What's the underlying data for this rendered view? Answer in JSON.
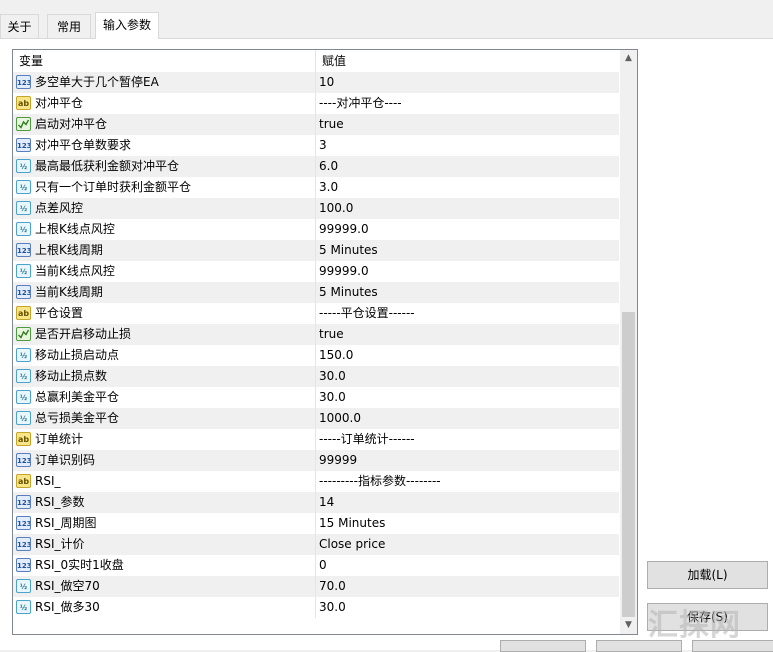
{
  "tabs": [
    {
      "label": "关于"
    },
    {
      "label": "常用"
    },
    {
      "label": "输入参数"
    }
  ],
  "table": {
    "col_variable": "变量",
    "col_value": "赋值",
    "rows": [
      {
        "icon": "int",
        "name": "多空单大于几个暂停EA",
        "value": "10"
      },
      {
        "icon": "str",
        "name": "对冲平仓",
        "value": "----对冲平仓----"
      },
      {
        "icon": "bool",
        "name": "启动对冲平仓",
        "value": "true"
      },
      {
        "icon": "int",
        "name": "对冲平仓单数要求",
        "value": "3"
      },
      {
        "icon": "dbl",
        "name": "最高最低获利金额对冲平仓",
        "value": "6.0"
      },
      {
        "icon": "dbl",
        "name": "只有一个订单时获利金额平仓",
        "value": "3.0"
      },
      {
        "icon": "dbl",
        "name": "点差风控",
        "value": "100.0"
      },
      {
        "icon": "dbl",
        "name": "上根K线点风控",
        "value": "99999.0"
      },
      {
        "icon": "int",
        "name": "上根K线周期",
        "value": "5 Minutes"
      },
      {
        "icon": "dbl",
        "name": "当前K线点风控",
        "value": "99999.0"
      },
      {
        "icon": "int",
        "name": "当前K线周期",
        "value": "5 Minutes"
      },
      {
        "icon": "str",
        "name": "平仓设置",
        "value": "-----平仓设置------"
      },
      {
        "icon": "bool",
        "name": "是否开启移动止损",
        "value": "true"
      },
      {
        "icon": "dbl",
        "name": "移动止损启动点",
        "value": "150.0"
      },
      {
        "icon": "dbl",
        "name": "移动止损点数",
        "value": "30.0"
      },
      {
        "icon": "dbl",
        "name": "总赢利美金平仓",
        "value": "30.0"
      },
      {
        "icon": "dbl",
        "name": "总亏损美金平仓",
        "value": "1000.0"
      },
      {
        "icon": "str",
        "name": "订单统计",
        "value": "-----订单统计------"
      },
      {
        "icon": "int",
        "name": "订单识别码",
        "value": "99999"
      },
      {
        "icon": "str",
        "name": "RSI_",
        "value": "---------指标参数--------"
      },
      {
        "icon": "int",
        "name": "RSI_参数",
        "value": "14"
      },
      {
        "icon": "int",
        "name": "RSI_周期图",
        "value": "15 Minutes"
      },
      {
        "icon": "int",
        "name": "RSI_计价",
        "value": "Close price"
      },
      {
        "icon": "int",
        "name": "RSI_0实时1收盘",
        "value": "0"
      },
      {
        "icon": "dbl",
        "name": "RSI_做空70",
        "value": "70.0"
      },
      {
        "icon": "dbl",
        "name": "RSI_做多30",
        "value": "30.0"
      }
    ]
  },
  "icon_labels": {
    "int": "123",
    "dbl": "½",
    "str": "ab"
  },
  "buttons": {
    "load": "加载(L)",
    "save": "保存(S)"
  },
  "watermark": "汇探网"
}
